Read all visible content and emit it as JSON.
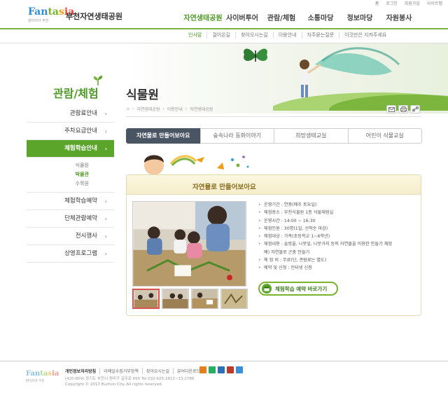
{
  "utility": [
    "홈",
    "로그인",
    "회원가입",
    "사이트맵"
  ],
  "logo": {
    "word": [
      "Fan",
      "ta",
      "s",
      "ia"
    ],
    "sub": "판타지아 부천",
    "name": "부천자연생태공원"
  },
  "mainnav": [
    "자연생태공원",
    "사이버투어",
    "관람/체험",
    "소통마당",
    "정보마당",
    "자원봉사"
  ],
  "subnav": [
    "인사말",
    "걸어온길",
    "찾아오시는길",
    "이용안내",
    "자주묻는질문",
    "이것만은 지켜주세요"
  ],
  "sidebar": {
    "title": "관람/체험",
    "items": [
      {
        "label": "관람료안내",
        "arrow": "›"
      },
      {
        "label": "주차요금안내",
        "arrow": "›"
      },
      {
        "label": "체험학습안내",
        "arrow": "›"
      },
      {
        "label": "체험학습예약",
        "arrow": "›"
      },
      {
        "label": "단체관람예약",
        "arrow": "›"
      },
      {
        "label": "전시행사",
        "arrow": "›"
      },
      {
        "label": "상영프로그램",
        "arrow": "›"
      }
    ],
    "subitems": [
      "식물원",
      "박물관",
      "수목원"
    ]
  },
  "page": {
    "title": "식물원",
    "breadcrumb": [
      "자연생태공원",
      "이용안내",
      "자연생태공원"
    ]
  },
  "tabs": [
    "자연물로 만들어보아요",
    "숲속나라 동화이야기",
    "희망생태교실",
    "어린이 식물교실"
  ],
  "program": {
    "title": "자연물로 만들어보아요",
    "info": [
      "운영기간 : 연중(매주 토요일)",
      "체험장소 : 부천식물원 1층 식물체험실",
      "운영시간 : 14:00 ~ 16:30",
      "체험인원 : 30명(1일, 선착순 마감)",
      "체험대상 : 가족(초등학교 1~6학년)",
      "체험내용 : 솔방울, 나뭇잎, 나뭇가지 등의 자연물을 이용한 만들기 체험",
      "예) 자연물로 곤충 만들기",
      "체 험 비 : 무료(단, 관람료는 별도)",
      "예약 및 신청 : 인터넷 신청"
    ],
    "apply_label": "체험학습 예약 바로가기"
  },
  "footer": {
    "links": [
      "개인정보처리방침",
      "이메일수집거부정책",
      "찾아오시는길",
      "뷰어다운로드"
    ],
    "address": "(420-859) 경기도 부천시 원미구 길주로 660  Tel.032-625-2811~13,2786",
    "copyright": "Copyright © 2013 Buchon City.  All rights reserved."
  },
  "colors": {
    "brand_green": "#5aa52a",
    "tab_active": "#4a5563",
    "title_gold": "#8a6d1d"
  }
}
